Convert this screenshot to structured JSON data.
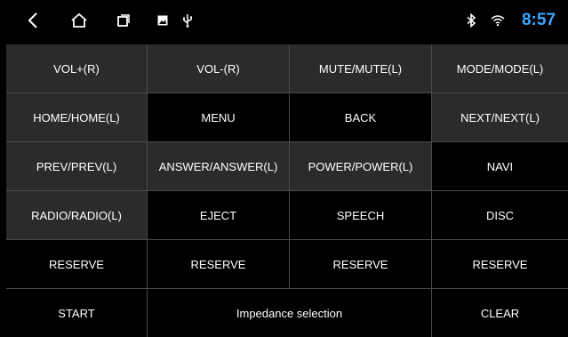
{
  "status_bar": {
    "icons": {
      "back": "chevron-left-icon",
      "home": "home-icon",
      "recents": "recent-apps-icon",
      "image": "image-icon",
      "usb": "usb-icon",
      "bluetooth": "bluetooth-icon",
      "wifi": "wifi-icon"
    },
    "time": "8:57",
    "time_color": "#3aa7ff"
  },
  "buttons": [
    [
      "VOL+(R)",
      "VOL-(R)",
      "MUTE/MUTE(L)",
      "MODE/MODE(L)"
    ],
    [
      "HOME/HOME(L)",
      "MENU",
      "BACK",
      "NEXT/NEXT(L)"
    ],
    [
      "PREV/PREV(L)",
      "ANSWER/ANSWER(L)",
      "POWER/POWER(L)",
      "NAVI"
    ],
    [
      "RADIO/RADIO(L)",
      "EJECT",
      "SPEECH",
      "DISC"
    ],
    [
      "RESERVE",
      "RESERVE",
      "RESERVE",
      "RESERVE"
    ]
  ],
  "bottom_row": {
    "start": "START",
    "impedance": "Impedance selection",
    "clear": "CLEAR"
  },
  "colors": {
    "assigned_button_bg": "#2b2b2b",
    "unassigned_button_bg": "#000000",
    "divider": "#4a4a4a"
  }
}
